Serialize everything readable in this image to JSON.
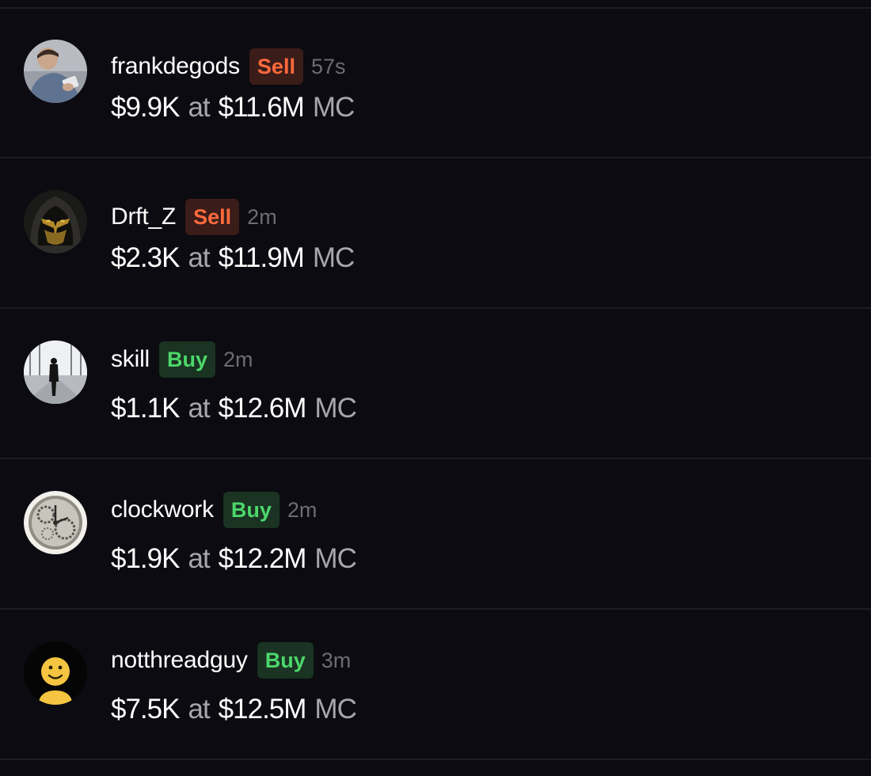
{
  "feed": {
    "rows": [
      {
        "username": "frankdegods",
        "action": "Sell",
        "time": "57s",
        "amount": "$9.9K",
        "at": "at",
        "market_cap": "$11.6M",
        "mc": "MC",
        "avatar_icon": "person-reclining-photo"
      },
      {
        "username": "Drft_Z",
        "action": "Sell",
        "time": "2m",
        "amount": "$2.3K",
        "at": "at",
        "market_cap": "$11.9M",
        "mc": "MC",
        "avatar_icon": "masked-ninja-photo"
      },
      {
        "username": "skill",
        "action": "Buy",
        "time": "2m",
        "amount": "$1.1K",
        "at": "at",
        "market_cap": "$12.6M",
        "mc": "MC",
        "avatar_icon": "silhouette-hallway-photo"
      },
      {
        "username": "clockwork",
        "action": "Buy",
        "time": "2m",
        "amount": "$1.9K",
        "at": "at",
        "market_cap": "$12.2M",
        "mc": "MC",
        "avatar_icon": "clock-gears-icon"
      },
      {
        "username": "notthreadguy",
        "action": "Buy",
        "time": "3m",
        "amount": "$7.5K",
        "at": "at",
        "market_cap": "$12.5M",
        "mc": "MC",
        "avatar_icon": "smiley-face-icon"
      }
    ]
  },
  "colors": {
    "background": "#0b0b11",
    "divider": "#1c1c24",
    "sell_text": "#ff6a3d",
    "sell_bg": "#3a1c18",
    "buy_text": "#4cd76b",
    "buy_bg": "#1a3322",
    "muted_text": "#a6a6ae",
    "time_text": "#6c6c76"
  }
}
